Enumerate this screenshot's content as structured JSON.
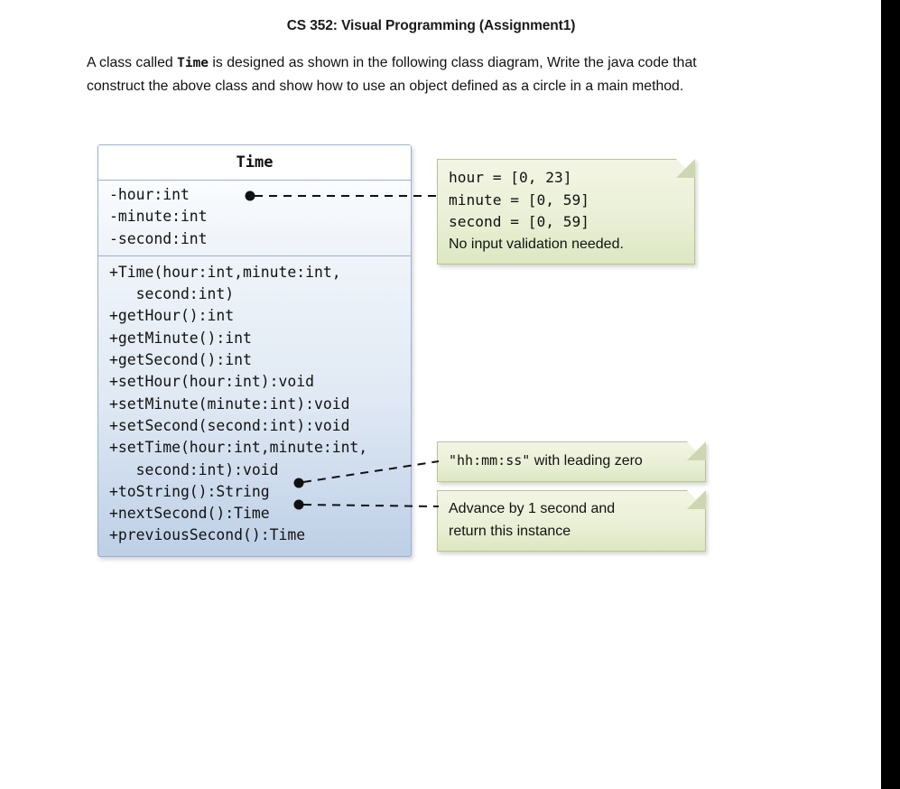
{
  "document": {
    "title": "CS 352: Visual Programming (Assignment1)",
    "paragraph": {
      "part1": "A class called ",
      "code": "Time",
      "part2": " is designed as shown in the following class diagram, Write the java code that construct the above class and show how to use an object defined as a circle in a main method."
    }
  },
  "class_diagram": {
    "class_name": "Time",
    "attributes": [
      "-hour:int",
      "-minute:int",
      "-second:int"
    ],
    "methods": [
      "+Time(hour:int,minute:int,",
      "   second:int)",
      "+getHour():int",
      "+getMinute():int",
      "+getSecond():int",
      "+setHour(hour:int):void",
      "+setMinute(minute:int):void",
      "+setSecond(second:int):void",
      "+setTime(hour:int,minute:int,",
      "   second:int):void",
      "+toString():String",
      "+nextSecond():Time",
      "+previousSecond():Time"
    ],
    "notes": {
      "ranges": {
        "line1": "hour = [0, 23]",
        "line2": "minute = [0, 59]",
        "line3": "second = [0, 59]",
        "line4": "No input validation needed."
      },
      "format": {
        "code": "\"hh:mm:ss\"",
        "text": " with leading zero"
      },
      "advance": {
        "line1": "Advance by 1 second and",
        "line2": "return this instance"
      }
    }
  },
  "colors": {
    "class_border": "#9bb0cc",
    "class_fill_top": "#fdfeff",
    "class_fill_bottom": "#bdcfe6",
    "note_border": "#b8c499",
    "note_fill": "#eaf0d6",
    "connector": "#1a1a1a",
    "page_background": "#ffffff",
    "right_band": "#000000"
  }
}
